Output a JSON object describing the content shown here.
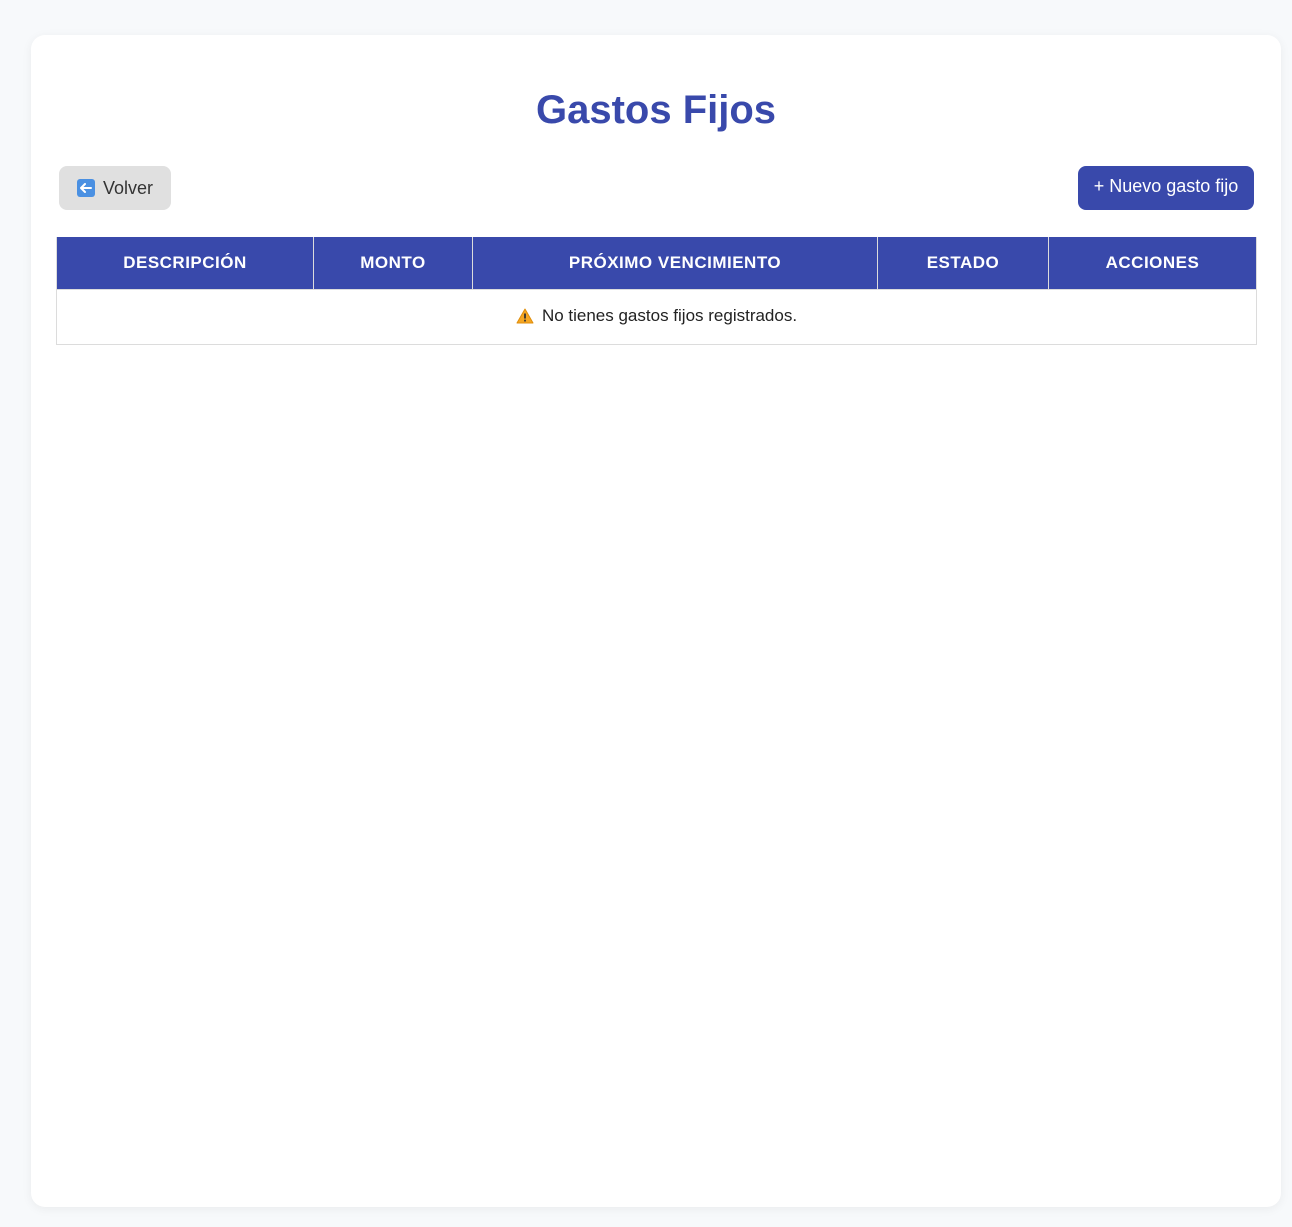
{
  "page": {
    "title": "Gastos Fijos"
  },
  "toolbar": {
    "back_label": "Volver",
    "back_icon": "back-arrow-icon",
    "new_label": "+ Nuevo gasto fijo"
  },
  "table": {
    "columns": [
      "Descripción",
      "Monto",
      "Próximo vencimiento",
      "Estado",
      "Acciones"
    ],
    "empty_message": "No tienes gastos fijos registrados.",
    "empty_icon": "warning-icon"
  },
  "colors": {
    "accent": "#3949ab",
    "back_button_bg": "#e0e0e0",
    "page_bg": "#f7f9fb"
  }
}
